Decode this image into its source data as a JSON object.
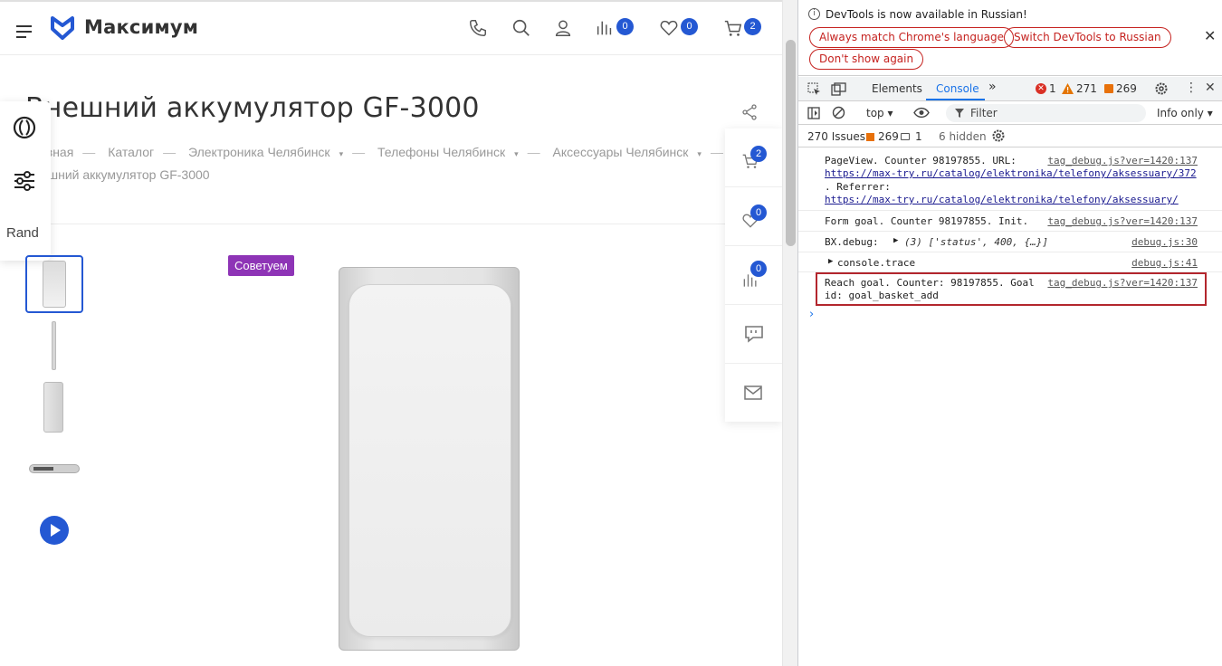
{
  "site": {
    "logo_text": "Максимум",
    "badges": {
      "compare": "0",
      "favorites": "0",
      "cart": "2"
    },
    "title": "Внешний аккумулятор GF-3000",
    "breadcrumbs": [
      "Главная",
      "Каталог",
      "Электроника Челябинск",
      "Телефоны Челябинск",
      "Аксессуары Челябинск"
    ],
    "breadcrumb_current": "Внешний аккумулятор GF-3000",
    "side_panel_label": "Rand",
    "right_panel_badges": {
      "cart": "2",
      "favorites": "0",
      "compare": "0"
    },
    "product_badge": "Советуем"
  },
  "devtools": {
    "notice": "DevTools is now available in Russian!",
    "buttons": [
      "Always match Chrome's language",
      "Switch DevTools to Russian",
      "Don't show again"
    ],
    "tabs": {
      "elements": "Elements",
      "console": "Console"
    },
    "counts": {
      "errors": "1",
      "warnings": "271",
      "issues": "269"
    },
    "context": "top",
    "filter_placeholder": "Filter",
    "level": "Info only",
    "issues_bar": {
      "label": "270 Issues:",
      "i1": "269",
      "i2": "1",
      "hidden": "6 hidden"
    },
    "logs": [
      {
        "l1": "PageView. Counter 98197855. URL:",
        "l2": "https://max-try.ru/catalog/elektronika/telefony/aksessuary/372",
        "l3": ". Referrer:",
        "l4": "https://max-try.ru/catalog/elektronika/telefony/aksessuary/",
        "src": "tag_debug.js?ver=1420:137"
      },
      {
        "l1": "Form goal. Counter 98197855. Init.",
        "src": "tag_debug.js?ver=1420:137"
      },
      {
        "l1": "BX.debug:",
        "l2": "(3) ['status', 400, {…}]",
        "src": "debug.js:30"
      },
      {
        "l1": "console.trace",
        "src": "debug.js:41"
      },
      {
        "l1": "Reach goal. Counter: 98197855. Goal",
        "l2": "id: goal_basket_add",
        "src": "tag_debug.js?ver=1420:137"
      }
    ]
  }
}
